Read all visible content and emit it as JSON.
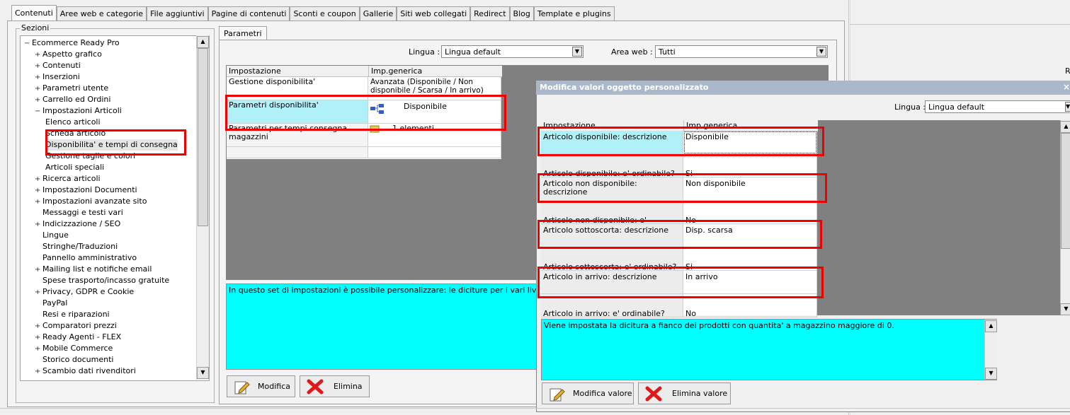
{
  "top_tabs": [
    "Contenuti",
    "Aree web e categorie",
    "File aggiuntivi",
    "Pagine di contenuti",
    "Sconti e coupon",
    "Gallerie",
    "Siti web collegati",
    "Redirect",
    "Blog",
    "Template e plugins"
  ],
  "sezioni": {
    "legend": "Sezioni",
    "items": [
      {
        "label": "Ecommerce Ready Pro",
        "sign": "−"
      },
      {
        "label": "Aspetto grafico",
        "sign": "+"
      },
      {
        "label": "Contenuti",
        "sign": "+"
      },
      {
        "label": "Inserzioni",
        "sign": "+"
      },
      {
        "label": "Parametri utente",
        "sign": "+"
      },
      {
        "label": "Carrello ed Ordini",
        "sign": "+"
      },
      {
        "label": "Impostazioni Articoli",
        "sign": "−"
      },
      {
        "label": "Elenco articoli",
        "sign": ""
      },
      {
        "label": "Scheda articolo",
        "sign": ""
      },
      {
        "label": "Disponibilita' e tempi di consegna",
        "sign": ""
      },
      {
        "label": "Gestione taglie e colori",
        "sign": ""
      },
      {
        "label": "Articoli speciali",
        "sign": ""
      },
      {
        "label": "Ricerca articoli",
        "sign": "+"
      },
      {
        "label": "Impostazioni Documenti",
        "sign": "+"
      },
      {
        "label": "Impostazioni avanzate sito",
        "sign": "+"
      },
      {
        "label": "Messaggi e testi vari",
        "sign": ""
      },
      {
        "label": "Indicizzazione / SEO",
        "sign": "+"
      },
      {
        "label": "Lingue",
        "sign": ""
      },
      {
        "label": "Stringhe/Traduzioni",
        "sign": ""
      },
      {
        "label": "Pannello amministrativo",
        "sign": ""
      },
      {
        "label": "Mailing list e notifiche email",
        "sign": "+"
      },
      {
        "label": "Spese trasporto/incasso gratuite",
        "sign": ""
      },
      {
        "label": "Privacy, GDPR e Cookie",
        "sign": "+"
      },
      {
        "label": "PayPal",
        "sign": ""
      },
      {
        "label": "Resi e riparazioni",
        "sign": ""
      },
      {
        "label": "Comparatori prezzi",
        "sign": "+"
      },
      {
        "label": "Ready Agenti - FLEX",
        "sign": "+"
      },
      {
        "label": "Mobile Commerce",
        "sign": "+"
      },
      {
        "label": "Storico documenti",
        "sign": ""
      },
      {
        "label": "Scambio dati rivenditori",
        "sign": "+"
      }
    ]
  },
  "parametri": {
    "tab": "Parametri",
    "lingua_label": "Lingua :",
    "lingua_value": "Lingua default",
    "area_label": "Area web :",
    "area_value": "Tutti",
    "col1": "Impostazione",
    "col2": "Imp.generica",
    "rows": [
      {
        "name": "Gestione disponibilita'",
        "value": "Avanzata (Disponibile / Non disponibile / Scarsa / In arrivo)"
      },
      {
        "name": "Parametri disponibilita'",
        "value": "Disponibile"
      },
      {
        "name": "Parametri per tempi consegna magazzini",
        "value": "1 elementi"
      }
    ],
    "description": "In questo set di impostazioni è possibile personalizzare: le diciture per i vari livelli di disponibilità, rendere ordinabili o non ordinabili gli articoli in base alla loro disponibilità, limitare l'ordine alla sole quantità disponibili.",
    "btn_modifica": "Modifica",
    "btn_elimina": "Elimina"
  },
  "dialog": {
    "title": "Modifica valori oggetto personalizzato",
    "close": "×",
    "lingua_label": "Lingua :",
    "lingua_value": "Lingua default",
    "col1": "Impostazione",
    "col2": "Imp.generica",
    "rows": [
      {
        "name": "Articolo disponibile: descrizione",
        "value": "Disponibile"
      },
      {
        "name": "Articolo disponibile: e' ordinabile?",
        "value": "Si"
      },
      {
        "name": "Articolo non disponibile: descrizione",
        "value": "Non disponibile"
      },
      {
        "name": "Articolo non disponibile: e' ordinabile?",
        "value": "No"
      },
      {
        "name": "Articolo sottoscorta: descrizione",
        "value": "Disp. scarsa"
      },
      {
        "name": "Articolo sottoscorta: e' ordinabile?",
        "value": "Si"
      },
      {
        "name": "Articolo in arrivo: descrizione",
        "value": "In arrivo"
      },
      {
        "name": "Articolo in arrivo: e' ordinabile?",
        "value": "No"
      }
    ],
    "description": "Viene impostata la dicitura a fianco dei prodotti con quantita' a magazzino maggiore di 0.",
    "btn_modifica": "Modifica valore",
    "btn_elimina": "Elimina valore"
  },
  "right_letter": "R",
  "colors": {
    "highlight_red": "#e00000",
    "cyan": "#00ffff",
    "selected_cell": "#b0f0f8",
    "grid_bg": "#808080"
  }
}
